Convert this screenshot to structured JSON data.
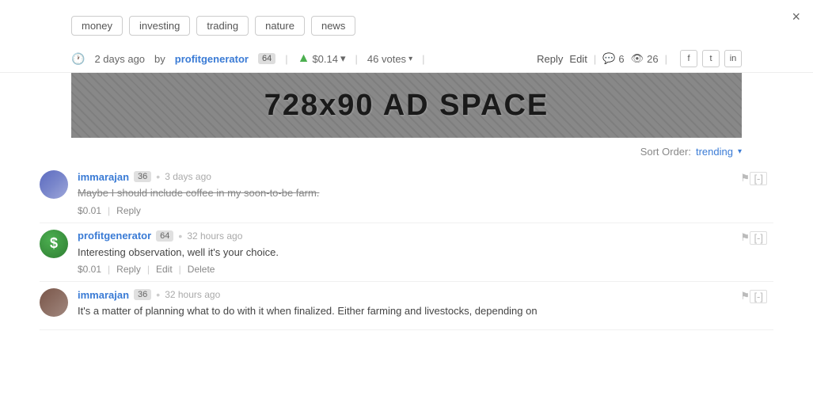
{
  "close": "×",
  "tags": [
    "money",
    "investing",
    "trading",
    "nature",
    "news"
  ],
  "meta": {
    "time": "2 days ago",
    "by": "by",
    "username": "profitgenerator",
    "badge": "64",
    "payout": "$0.14",
    "votes_count": "46 votes",
    "reply": "Reply",
    "edit": "Edit",
    "comments_count": "6",
    "views_count": "26",
    "facebook": "f",
    "twitter": "t",
    "linkedin": "in"
  },
  "ad": {
    "text": "728x90 AD SPACE"
  },
  "sort": {
    "label": "Sort Order:",
    "value": "trending"
  },
  "comments": [
    {
      "id": 1,
      "username": "immarajan",
      "badge": "36",
      "time": "3 days ago",
      "text": "Maybe I should include coffee in my soon-to-be farm.",
      "payout": "$0.01",
      "reply": "Reply",
      "edit": null,
      "delete": null
    },
    {
      "id": 2,
      "username": "profitgenerator",
      "badge": "64",
      "time": "32 hours ago",
      "text": "Interesting observation, well it's your choice.",
      "payout": "$0.01",
      "reply": "Reply",
      "edit": "Edit",
      "delete": "Delete"
    },
    {
      "id": 3,
      "username": "immarajan",
      "badge": "36",
      "time": "32 hours ago",
      "text": "It's a matter of planning what to do with it when finalized. Either farming and livestocks, depending on",
      "payout": null,
      "reply": null,
      "edit": null,
      "delete": null
    }
  ]
}
